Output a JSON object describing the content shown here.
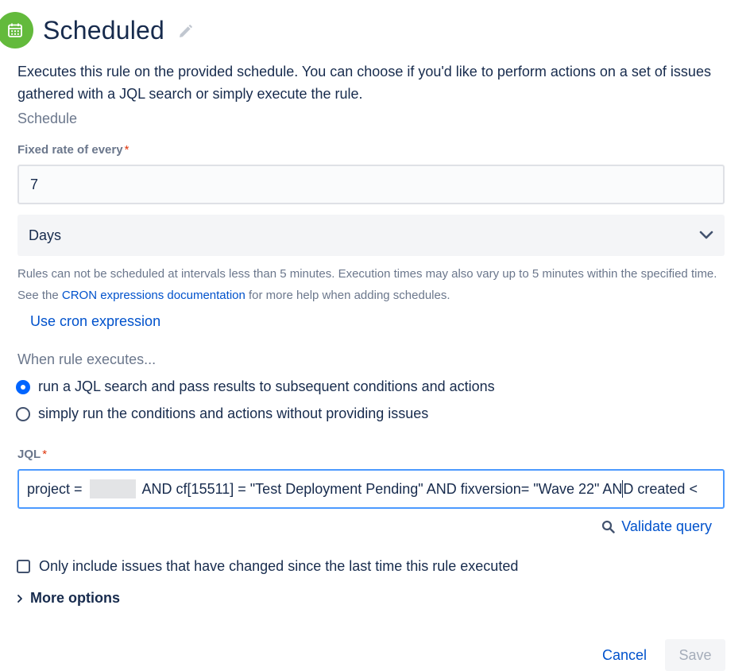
{
  "header": {
    "title": "Scheduled",
    "icon": "calendar-icon",
    "icon_bg": "#63ba3c"
  },
  "description": "Executes this rule on the provided schedule. You can choose if you'd like to perform actions on a set of issues gathered with a JQL search or simply execute the rule.",
  "schedule": {
    "section_label": "Schedule",
    "fixed_rate_label": "Fixed rate of every",
    "required_mark": "*",
    "fixed_rate_value": "7",
    "unit_value": "Days",
    "help_before": "Rules can not be scheduled at intervals less than 5 minutes. Execution times may also vary up to 5 minutes within the specified time. See the ",
    "help_link": "CRON expressions documentation",
    "help_after": " for more help when adding schedules.",
    "cron_link": "Use cron expression"
  },
  "execution": {
    "label": "When rule executes...",
    "options": [
      {
        "label": "run a JQL search and pass results to subsequent conditions and actions",
        "selected": true
      },
      {
        "label": "simply run the conditions and actions without providing issues",
        "selected": false
      }
    ]
  },
  "jql": {
    "label": "JQL",
    "required_mark": "*",
    "prefix": "project = ",
    "mid": " AND cf[15511] = \"Test Deployment Pending\" AND fixversion= \"Wave 22\" AN",
    "suffix": "D created <",
    "validate_label": "Validate query"
  },
  "only_changed": {
    "label": "Only include issues that have changed since the last time this rule executed",
    "checked": false
  },
  "more_options_label": "More options",
  "footer": {
    "cancel_label": "Cancel",
    "save_label": "Save"
  },
  "colors": {
    "link": "#0052cc",
    "focus_border": "#4c9aff",
    "radio_selected": "#0065ff",
    "required": "#de350b"
  }
}
